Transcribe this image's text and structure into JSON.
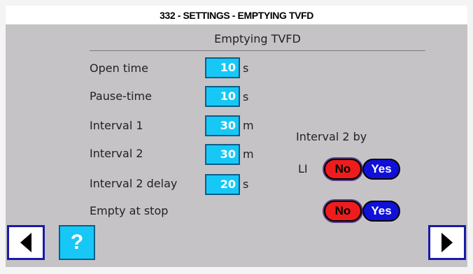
{
  "title": "332 - SETTINGS - EMPTYING TVFD",
  "section_title": "Emptying TVFD",
  "settings": [
    {
      "label": "Open time",
      "value": "10",
      "unit": "s"
    },
    {
      "label": "Pause-time",
      "value": "10",
      "unit": "s"
    },
    {
      "label": "Interval 1",
      "value": "30",
      "unit": "m"
    },
    {
      "label": "Interval 2",
      "value": "30",
      "unit": "m"
    },
    {
      "label": "Interval 2 delay",
      "value": "20",
      "unit": "s"
    }
  ],
  "interval2_by": {
    "heading": "Interval 2 by",
    "option_label": "LI",
    "no_label": "No",
    "yes_label": "Yes",
    "selected": "No"
  },
  "empty_at_stop": {
    "label": "Empty at stop",
    "no_label": "No",
    "yes_label": "Yes",
    "selected": "No"
  },
  "nav": {
    "help_label": "?",
    "prev_icon": "triangle-left-icon",
    "next_icon": "triangle-right-icon"
  },
  "colors": {
    "panel_bg": "#c6c3c6",
    "value_bg": "#17c8f6",
    "no_red": "#ee1c1c",
    "yes_blue": "#1010d8",
    "nav_border": "#1a1aa8"
  }
}
